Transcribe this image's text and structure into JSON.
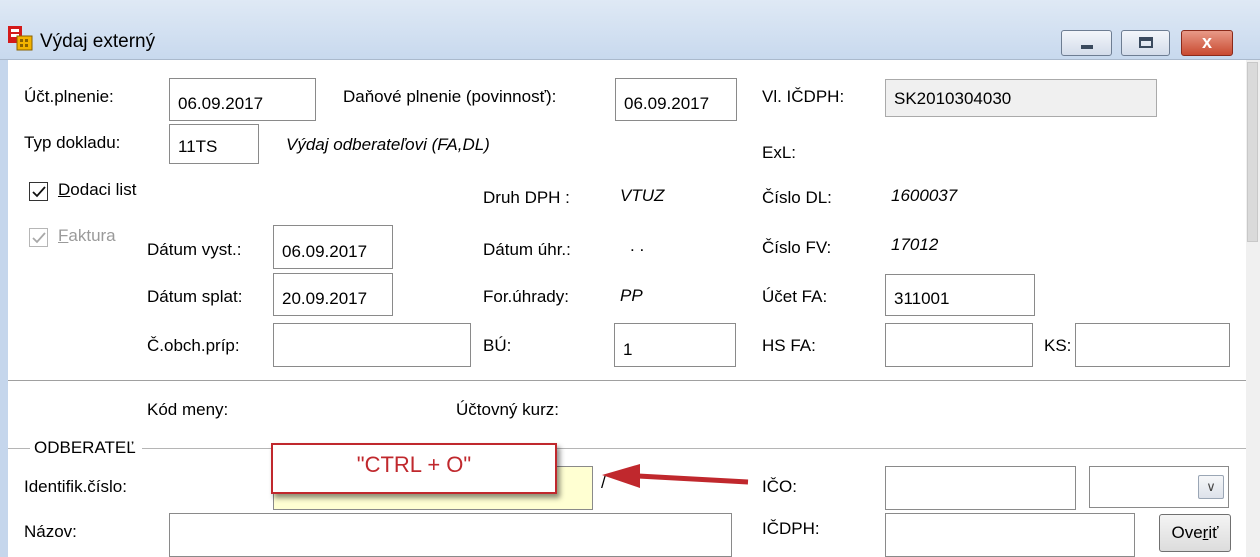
{
  "window": {
    "title": "Výdaj externý",
    "close_glyph": "x",
    "minimize_glyph": "minimize-icon",
    "maximize_glyph": "maximize-icon"
  },
  "header": {
    "uct_plnenie_label": "Účt.plnenie:",
    "uct_plnenie_value": "06.09.2017",
    "danove_plnenie_label": "Daňové plnenie (povinnosť):",
    "danove_plnenie_value": "06.09.2017",
    "vl_icdph_label": "Vl. IČDPH:",
    "vl_icdph_value": "SK2010304030",
    "typ_dokladu_label": "Typ dokladu:",
    "typ_dokladu_value": "11TS",
    "typ_dokladu_desc": "Výdaj odberateľovi (FA,DL)",
    "exl_label": "ExL:"
  },
  "checkboxes": {
    "dodaci_list_mnemonic": "D",
    "dodaci_list_rest": "odaci list",
    "dodaci_list_checked": true,
    "faktura_mnemonic": "F",
    "faktura_rest": "aktura",
    "faktura_checked": true
  },
  "details": {
    "druh_dph_label": "Druh DPH  :",
    "druh_dph_value": "VTUZ",
    "cislo_dl_label": "Číslo DL:",
    "cislo_dl_value": "1600037",
    "datum_vyst_label": "Dátum vyst.:",
    "datum_vyst_value": "06.09.2017",
    "datum_uhr_label": "Dátum úhr.:",
    "datum_uhr_value": ". .",
    "cislo_fv_label": "Číslo FV:",
    "cislo_fv_value": "17012",
    "datum_splat_label": "Dátum splat:",
    "datum_splat_value": "20.09.2017",
    "for_uhrady_label": "For.úhrady:",
    "for_uhrady_value": "PP",
    "ucet_fa_label": "Účet FA:",
    "ucet_fa_value": "311001",
    "c_obch_prip_label": "Č.obch.príp:",
    "c_obch_prip_value": "",
    "bu_label": "BÚ:",
    "bu_value": "1",
    "hs_fa_label": "HS FA:",
    "hs_fa_value": "",
    "ks_label": "KS:",
    "ks_value": ""
  },
  "currency": {
    "kod_meny_label": "Kód meny:",
    "uctovny_kurz_label": "Účtovný kurz:"
  },
  "odberatel": {
    "group_label": "ODBERATEĽ",
    "identif_label": "Identifik.číslo:",
    "identif_value": "",
    "slash": "/",
    "ico_label": "IČO:",
    "ico_value": "",
    "nazov_label": "Názov:",
    "nazov_value": "",
    "icdph_label": "IČDPH:",
    "icdph_value": "",
    "overit_pre": "Ove",
    "overit_mnemonic": "r",
    "overit_post": "iť",
    "combo_value": ""
  },
  "annotation": {
    "callout_text": "\"CTRL + O\"",
    "arrow_color": "#c0282d"
  },
  "colors": {
    "highlight_field": "#ffffd2",
    "callout_red": "#c0282d"
  }
}
